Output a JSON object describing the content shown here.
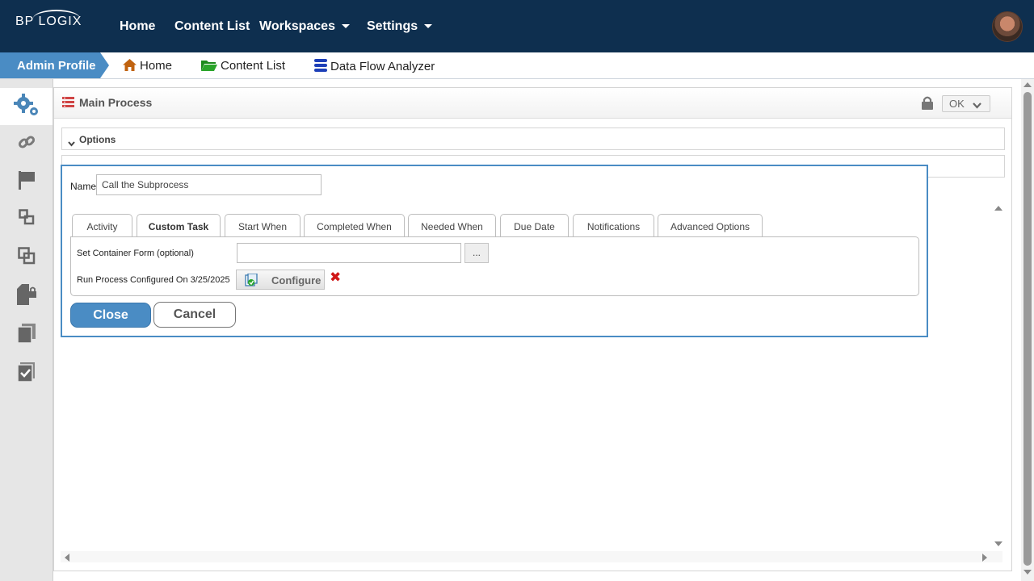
{
  "topbar": {
    "logo": "BP LOGIX",
    "nav": [
      {
        "label": "Home"
      },
      {
        "label": "Content List"
      },
      {
        "label": "Workspaces"
      },
      {
        "label": "Settings"
      }
    ]
  },
  "breadcrumb": {
    "profile": "Admin Profile",
    "items": [
      {
        "label": "Home",
        "icon": "home-icon"
      },
      {
        "label": "Content List",
        "icon": "folder-icon"
      },
      {
        "label": "Data Flow Analyzer",
        "icon": "database-icon"
      }
    ]
  },
  "sidebar": {
    "items": [
      "gears-icon",
      "link-icon",
      "flag-icon",
      "small-squares-icon",
      "overlap-squares-icon",
      "lock-file-icon",
      "documents-icon",
      "check-file-icon"
    ]
  },
  "main": {
    "title": "Main Process",
    "ok_label": "OK",
    "sections": [
      {
        "label": "Options"
      }
    ]
  },
  "dialog": {
    "name_label": "Name",
    "name_value": "Call the Subprocess",
    "tabs": [
      {
        "label": "Activity",
        "active": false
      },
      {
        "label": "Custom Task",
        "active": true
      },
      {
        "label": "Start When",
        "active": false
      },
      {
        "label": "Completed When",
        "active": false
      },
      {
        "label": "Needed When",
        "active": false
      },
      {
        "label": "Due Date",
        "active": false
      },
      {
        "label": "Notifications",
        "active": false
      },
      {
        "label": "Advanced Options",
        "active": false
      }
    ],
    "container_form_label": "Set Container Form (optional)",
    "container_form_value": "",
    "browse_label": "...",
    "run_process_label": "Run Process Configured On 3/25/2025",
    "configure_label": "Configure",
    "close_label": "Close",
    "cancel_label": "Cancel"
  },
  "colors": {
    "topbar": "#0e2f4f",
    "accent": "#4a8cc4",
    "delete": "#d01818"
  }
}
